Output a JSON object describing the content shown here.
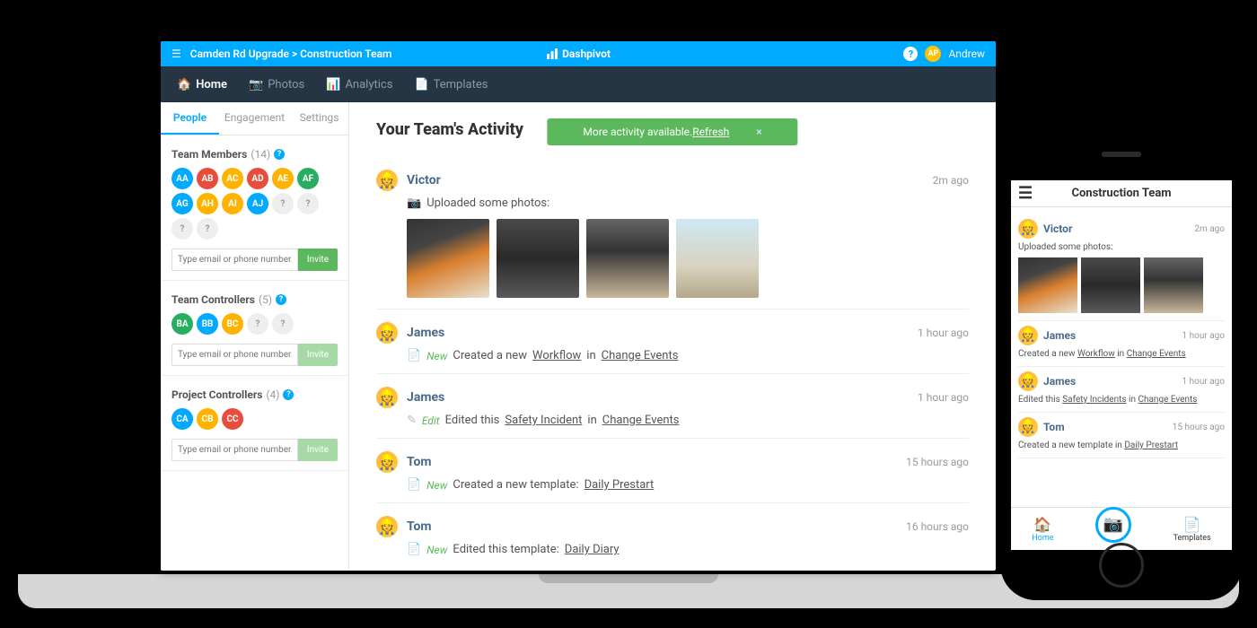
{
  "app": {
    "name": "Dashpivot",
    "breadcrumb": "Camden Rd Upgrade > Construction Team",
    "user": {
      "initials": "AP",
      "name": "Andrew"
    }
  },
  "nav": [
    {
      "label": "Home",
      "icon": "home",
      "active": true
    },
    {
      "label": "Photos",
      "icon": "camera",
      "active": false
    },
    {
      "label": "Analytics",
      "icon": "chart",
      "active": false
    },
    {
      "label": "Templates",
      "icon": "document",
      "active": false
    }
  ],
  "sidebar_tabs": [
    {
      "label": "People",
      "active": true
    },
    {
      "label": "Engagement",
      "active": false
    },
    {
      "label": "Settings",
      "active": false
    }
  ],
  "sections": {
    "members": {
      "title": "Team Members",
      "count": "(14)",
      "avatars": [
        {
          "t": "AA",
          "c": "#00aaff"
        },
        {
          "t": "AB",
          "c": "#e74c3c"
        },
        {
          "t": "AC",
          "c": "#ffb300"
        },
        {
          "t": "AD",
          "c": "#e74c3c"
        },
        {
          "t": "AE",
          "c": "#ffb300"
        },
        {
          "t": "AF",
          "c": "#27ae60"
        },
        {
          "t": "AG",
          "c": "#00aaff"
        },
        {
          "t": "AH",
          "c": "#ffb300"
        },
        {
          "t": "AI",
          "c": "#ffb300"
        },
        {
          "t": "AJ",
          "c": "#00aaff"
        },
        {
          "t": "?",
          "c": "q"
        },
        {
          "t": "?",
          "c": "q"
        },
        {
          "t": "?",
          "c": "q"
        },
        {
          "t": "?",
          "c": "q"
        }
      ],
      "placeholder": "Type email or phone number...",
      "invite": "Invite",
      "disabled": false
    },
    "controllers": {
      "title": "Team Controllers",
      "count": "(5)",
      "avatars": [
        {
          "t": "BA",
          "c": "#27ae60"
        },
        {
          "t": "BB",
          "c": "#00aaff"
        },
        {
          "t": "BC",
          "c": "#ffb300"
        },
        {
          "t": "?",
          "c": "q"
        },
        {
          "t": "?",
          "c": "q"
        }
      ],
      "placeholder": "Type email or phone number...",
      "invite": "Invite",
      "disabled": true
    },
    "project": {
      "title": "Project Controllers",
      "count": "(4)",
      "avatars": [
        {
          "t": "CA",
          "c": "#00aaff"
        },
        {
          "t": "CB",
          "c": "#ffb300"
        },
        {
          "t": "CC",
          "c": "#e74c3c"
        }
      ],
      "placeholder": "Type email or phone number...",
      "invite": "Invite",
      "disabled": true
    }
  },
  "main_title": "Your Team's Activity",
  "banner": {
    "text": "More activity available. ",
    "link": "Refresh"
  },
  "activities": [
    {
      "name": "Victor",
      "ago": "2m ago",
      "type": "photos",
      "text": "Uploaded some photos:"
    },
    {
      "name": "James",
      "ago": "1 hour ago",
      "type": "new",
      "pre": "Created a new ",
      "link1": "Workflow",
      "mid": " in ",
      "link2": "Change Events"
    },
    {
      "name": "James",
      "ago": "1 hour ago",
      "type": "edit",
      "pre": "Edited this ",
      "link1": "Safety Incident",
      "mid": " in ",
      "link2": "Change Events"
    },
    {
      "name": "Tom",
      "ago": "15 hours ago",
      "type": "new",
      "pre": "Created a new template: ",
      "link1": "Daily Prestart"
    },
    {
      "name": "Tom",
      "ago": "16 hours ago",
      "type": "new",
      "pre": "Edited this template: ",
      "link1": "Daily Diary"
    }
  ],
  "mobile": {
    "title": "Construction Team",
    "items": [
      {
        "name": "Victor",
        "ago": "2m ago",
        "text": "Uploaded some photos:",
        "photos": true
      },
      {
        "name": "James",
        "ago": "1 hour ago",
        "text_pre": "Created a new ",
        "link1": "Workflow",
        "mid": " in ",
        "link2": "Change Events"
      },
      {
        "name": "James",
        "ago": "1 hour ago",
        "text_pre": "Edited this ",
        "link1": "Safety Incidents",
        "mid": " in ",
        "link2": "Change Events"
      },
      {
        "name": "Tom",
        "ago": "15 hours ago",
        "text_pre": "Created a new template in ",
        "link1": "Daily Prestart"
      }
    ],
    "bottom": {
      "home": "Home",
      "templates": "Templates"
    }
  }
}
